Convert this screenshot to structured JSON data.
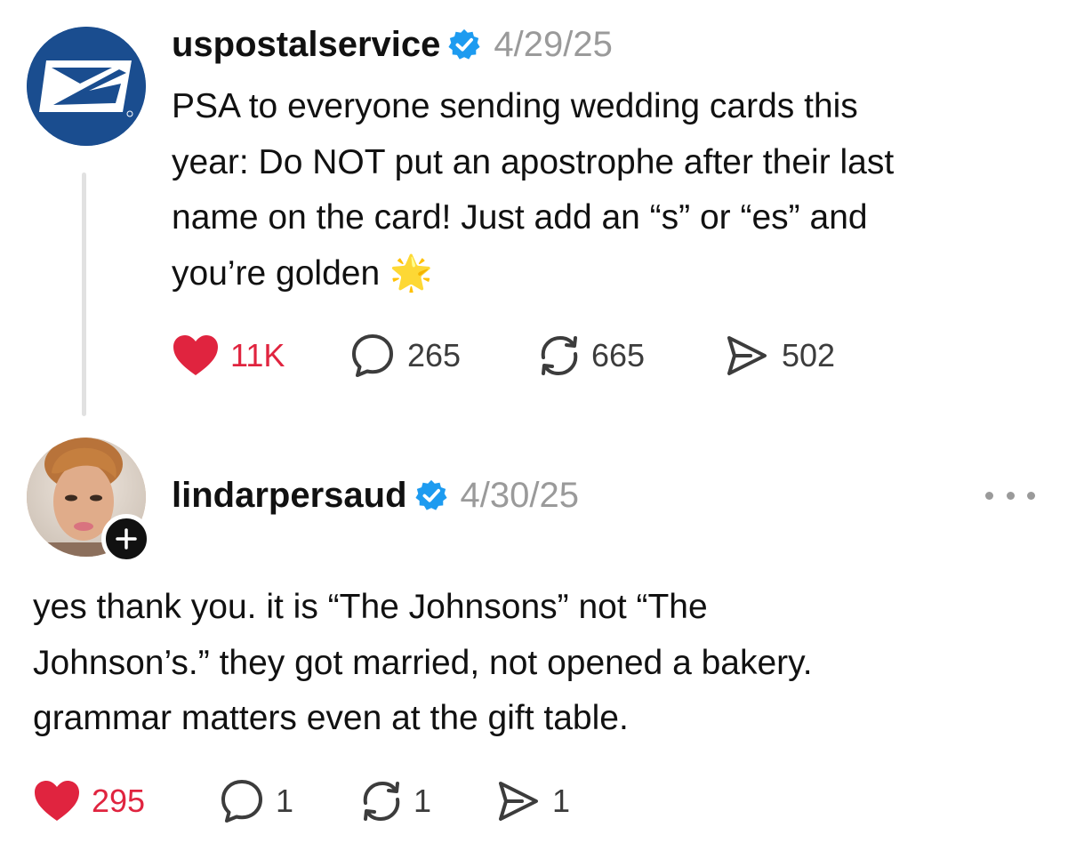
{
  "colors": {
    "like": "#e0243f",
    "verified": "#1d9bf0",
    "usps_blue": "#1a4d8f",
    "muted": "#9a9a9a"
  },
  "post": {
    "username": "uspostalservice",
    "verified": true,
    "date": "4/29/25",
    "avatar_icon": "usps-eagle-logo",
    "text_lines": [
      "PSA to everyone sending wedding cards this",
      "year: Do NOT put an apostrophe after their last",
      "name on the card! Just add an “s” or “es” and",
      "you’re golden 🌟"
    ],
    "actions": {
      "likes": "11K",
      "replies": "265",
      "reposts": "665",
      "shares": "502"
    }
  },
  "reply": {
    "username": "lindarpersaud",
    "verified": true,
    "date": "4/30/25",
    "avatar_icon": "profile-photo",
    "follow_icon": "plus-icon",
    "more_icon": "more-options-icon",
    "text_lines": [
      "yes thank you. it is “The Johnsons” not “The",
      "Johnson’s.” they got married, not opened a bakery.",
      "grammar matters even at the gift table."
    ],
    "actions": {
      "likes": "295",
      "replies": "1",
      "reposts": "1",
      "shares": "1"
    }
  }
}
